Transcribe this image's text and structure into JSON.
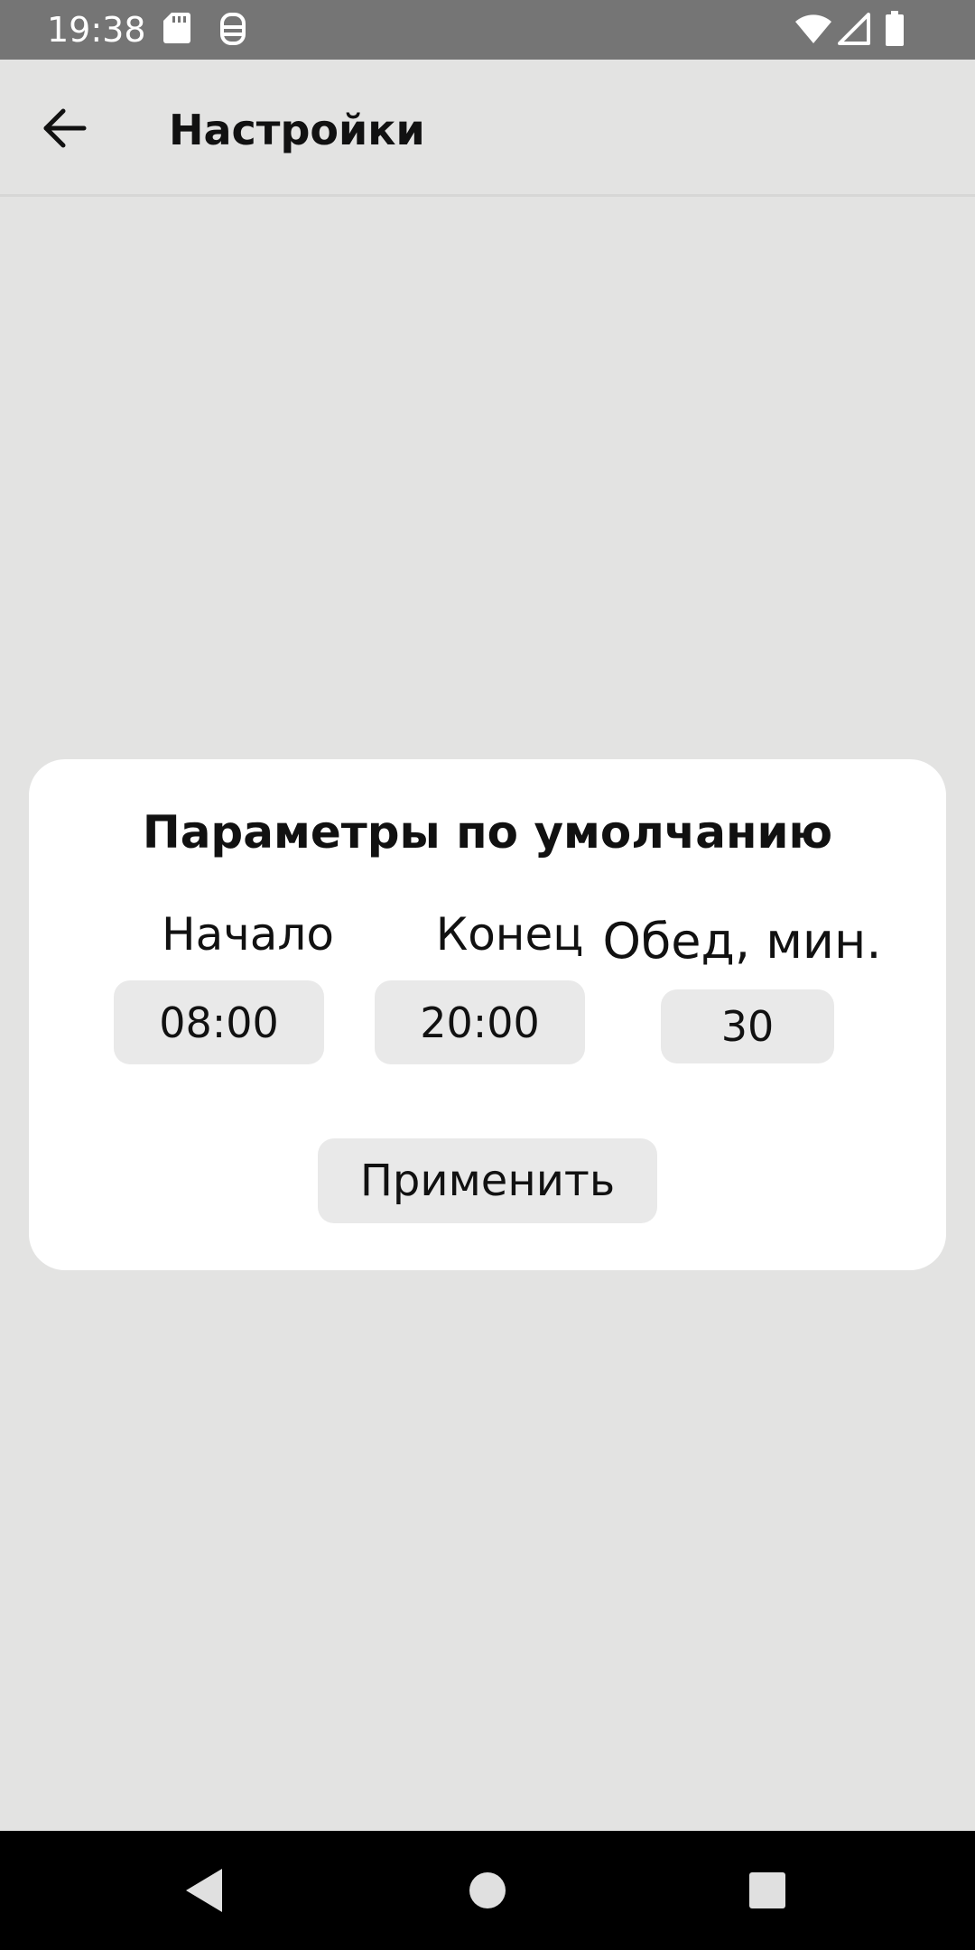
{
  "status_bar": {
    "time": "19:38",
    "icons": [
      "sd-card-icon",
      "debug-icon",
      "wifi-icon",
      "signal-icon",
      "battery-icon"
    ]
  },
  "app_bar": {
    "title": "Настройки",
    "back_icon": "arrow-back-icon"
  },
  "dialog": {
    "title": "Параметры по умолчанию",
    "fields": [
      {
        "label": "Начало",
        "value": "08:00"
      },
      {
        "label": "Конец",
        "value": "20:00"
      },
      {
        "label": "Обед, мин.",
        "value": "30"
      }
    ],
    "apply_label": "Применить"
  },
  "nav_bar": {
    "icons": [
      "back-triangle-icon",
      "home-circle-icon",
      "recents-square-icon"
    ]
  },
  "colors": {
    "background": "#e3e3e2",
    "status_bar": "#757575",
    "card": "#ffffff",
    "field": "#e9e9e9",
    "nav_bar": "#000000"
  }
}
